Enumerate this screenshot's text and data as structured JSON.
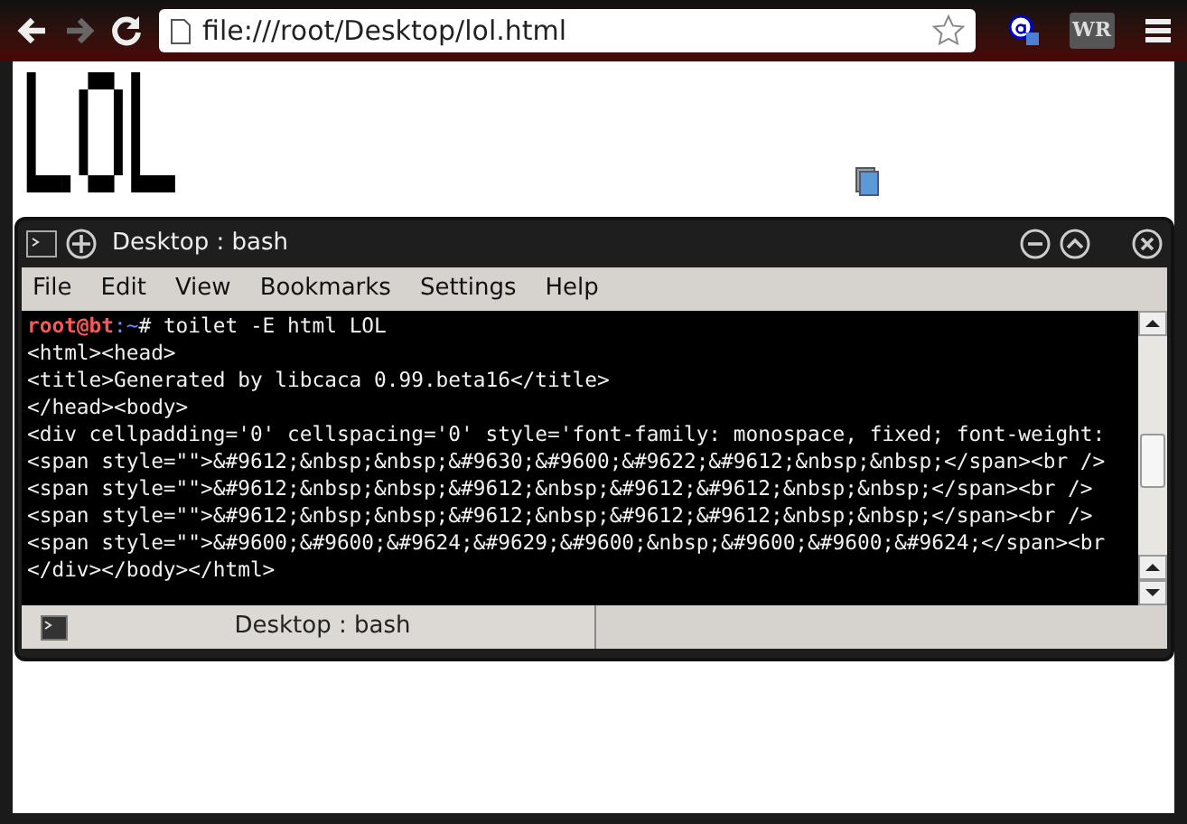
{
  "browser": {
    "back_disabled": false,
    "forward_disabled": true,
    "address": "file:///root/Desktop/lol.html",
    "extension_label": "WR"
  },
  "page": {
    "art_lines": [
      "▌  ▞▀▖▌  ",
      "▌  ▌ ▌▌  ",
      "▌  ▌ ▌▌  ",
      "▀▀▘▝▀ ▀▀▘"
    ]
  },
  "terminal": {
    "title": "Desktop : bash",
    "menu": [
      "File",
      "Edit",
      "View",
      "Bookmarks",
      "Settings",
      "Help"
    ],
    "prompt": {
      "user_host": "root@bt",
      "path": ":~",
      "command": "# toilet -E html LOL"
    },
    "lines": [
      "<html><head>",
      "<title>Generated by libcaca 0.99.beta16</title>",
      "</head><body>",
      "<div cellpadding='0' cellspacing='0' style='font-family: monospace, fixed; font-weight:",
      "<span style=\"\">&#9612;&nbsp;&nbsp;&#9630;&#9600;&#9622;&#9612;&nbsp;&nbsp;</span><br />",
      "<span style=\"\">&#9612;&nbsp;&nbsp;&#9612;&nbsp;&#9612;&#9612;&nbsp;&nbsp;</span><br />",
      "<span style=\"\">&#9612;&nbsp;&nbsp;&#9612;&nbsp;&#9612;&#9612;&nbsp;&nbsp;</span><br />",
      "<span style=\"\">&#9600;&#9600;&#9624;&#9629;&#9600;&nbsp;&#9600;&#9600;&#9624;</span><br",
      "</div></body></html>"
    ],
    "tabs": [
      {
        "label": "Desktop : bash",
        "selected": true
      }
    ]
  }
}
